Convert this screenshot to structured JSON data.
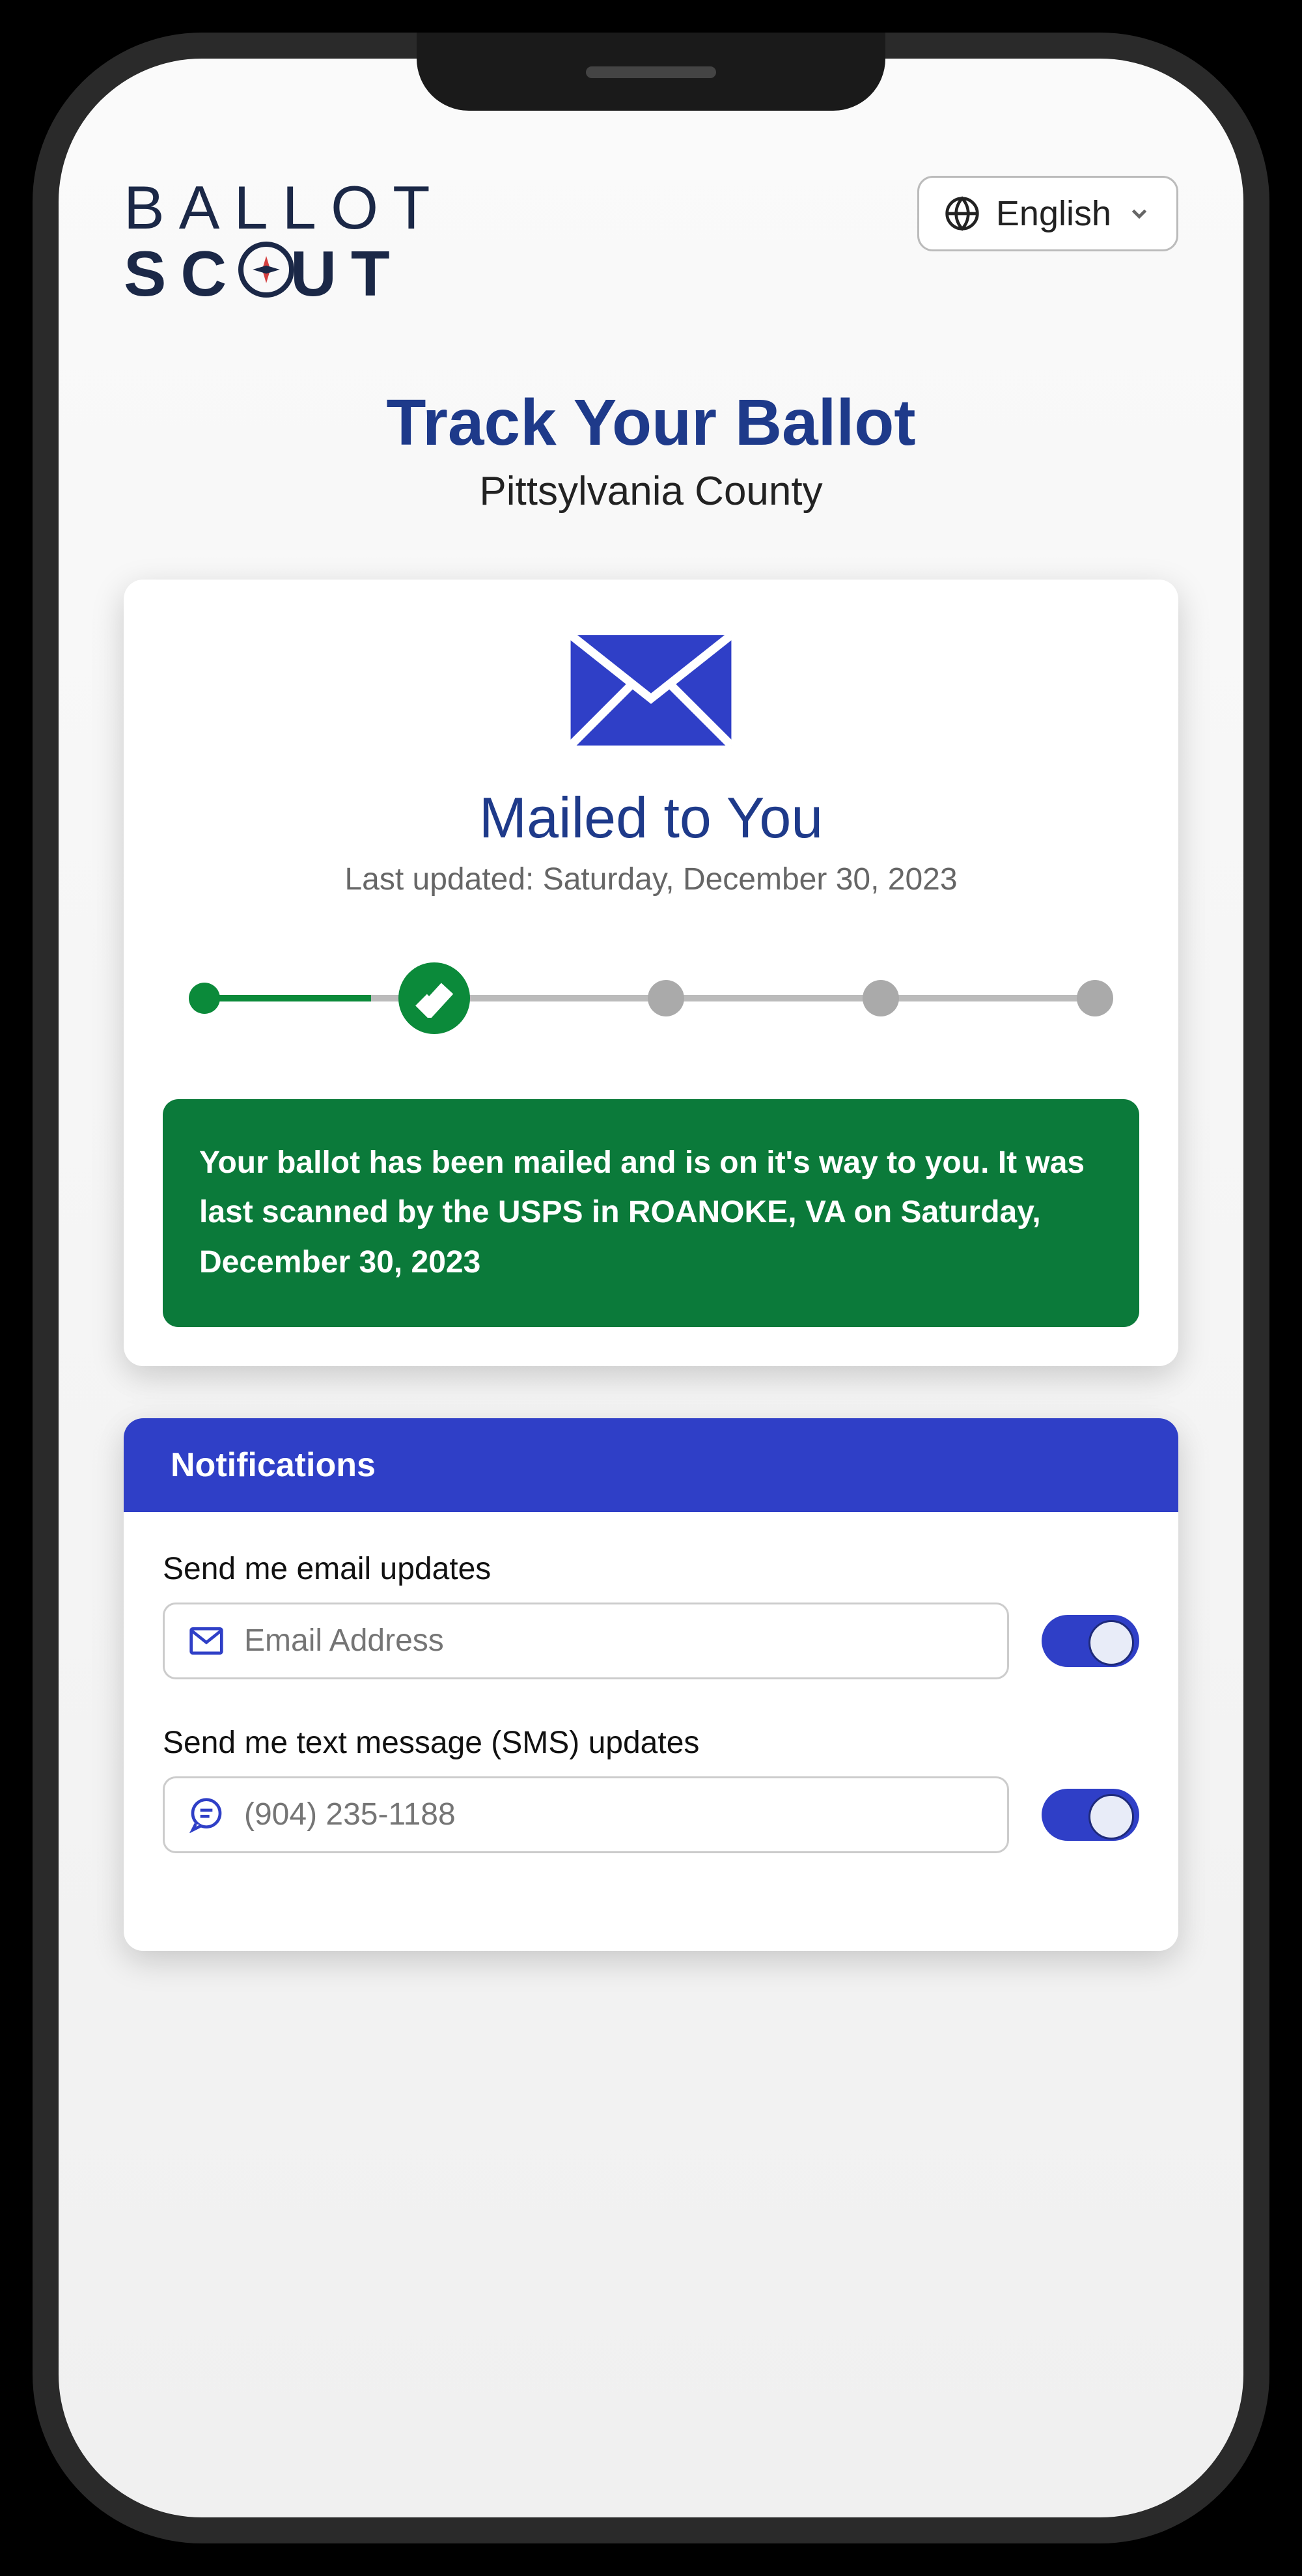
{
  "brand": {
    "line1": "BALLOT",
    "line2a": "SC",
    "line2b": "UT"
  },
  "language": {
    "selected": "English"
  },
  "heading": {
    "title": "Track Your Ballot",
    "subtitle": "Pittsylvania County"
  },
  "status": {
    "title": "Mailed to You",
    "updated": "Last updated: Saturday, December 30, 2023",
    "progress_step": 2,
    "progress_total": 5,
    "message": "Your ballot has been mailed and is on it's way to you. It was last scanned by the USPS in ROANOKE, VA on Saturday, December 30, 2023"
  },
  "notifications": {
    "header": "Notifications",
    "email": {
      "label": "Send me email updates",
      "placeholder": "Email Address",
      "value": "",
      "enabled": true
    },
    "sms": {
      "label": "Send me text message (SMS) updates",
      "placeholder": "(904) 235-1188",
      "value": "",
      "enabled": true
    }
  },
  "colors": {
    "primary_blue": "#2f3fc7",
    "heading_blue": "#1e3a8a",
    "success_green": "#0b7a3a"
  }
}
